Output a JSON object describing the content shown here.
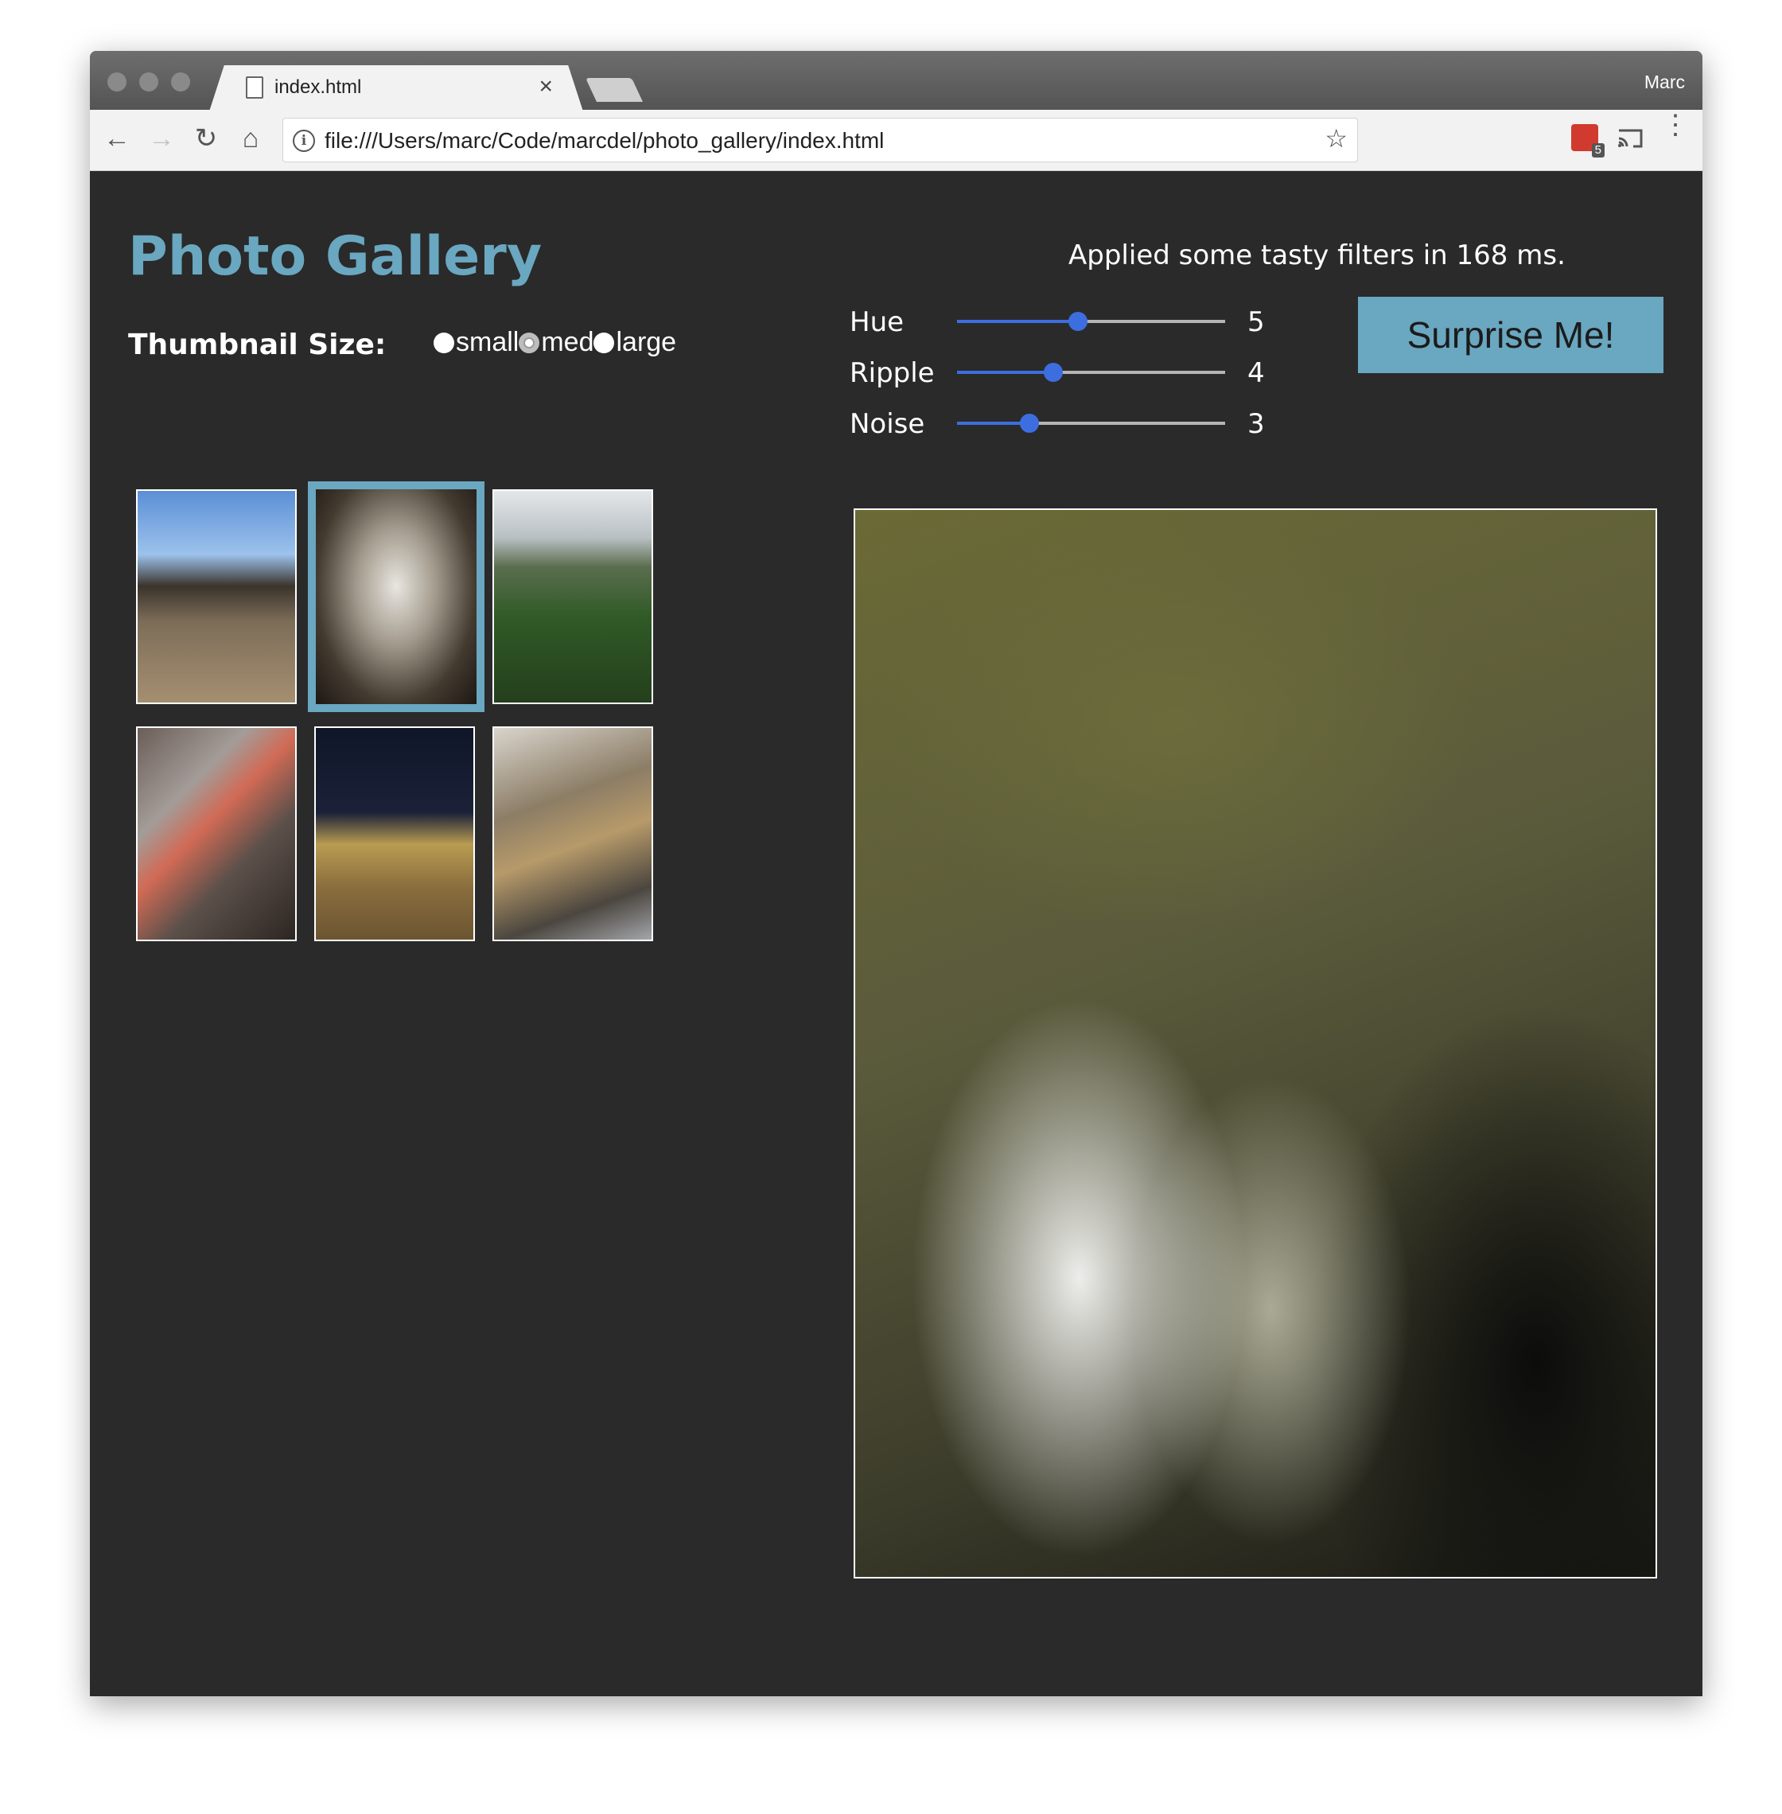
{
  "browser": {
    "tab_title": "index.html",
    "tab_close": "×",
    "profile_name": "Marc",
    "url": "file:///Users/marc/Code/marcdel/photo_gallery/index.html",
    "extension_badge": "5",
    "icons": {
      "back": "←",
      "forward": "→",
      "reload": "↻",
      "home": "⌂",
      "info": "i",
      "star": "☆",
      "menu": "⋮"
    }
  },
  "page": {
    "title": "Photo Gallery",
    "thumbnail_size_label": "Thumbnail Size:",
    "sizes": [
      {
        "label": "small",
        "checked": false
      },
      {
        "label": "med",
        "checked": true
      },
      {
        "label": "large",
        "checked": false
      }
    ],
    "filter_status": "Applied some tasty filters in 168 ms.",
    "sliders": [
      {
        "label": "Hue",
        "value": "5",
        "fraction": 0.45
      },
      {
        "label": "Ripple",
        "value": "4",
        "fraction": 0.36
      },
      {
        "label": "Noise",
        "value": "3",
        "fraction": 0.27
      }
    ],
    "surprise_button": "Surprise Me!",
    "thumbnails": [
      {
        "name": "beach",
        "selected": false
      },
      {
        "name": "concert",
        "selected": true
      },
      {
        "name": "jungle",
        "selected": false
      },
      {
        "name": "person-railing",
        "selected": false
      },
      {
        "name": "night-pier",
        "selected": false
      },
      {
        "name": "ship-in-bottle",
        "selected": false
      }
    ],
    "colors": {
      "accent": "#6aa7c0",
      "page_bg": "#2a2a2a",
      "slider": "#3d6ee0"
    }
  }
}
